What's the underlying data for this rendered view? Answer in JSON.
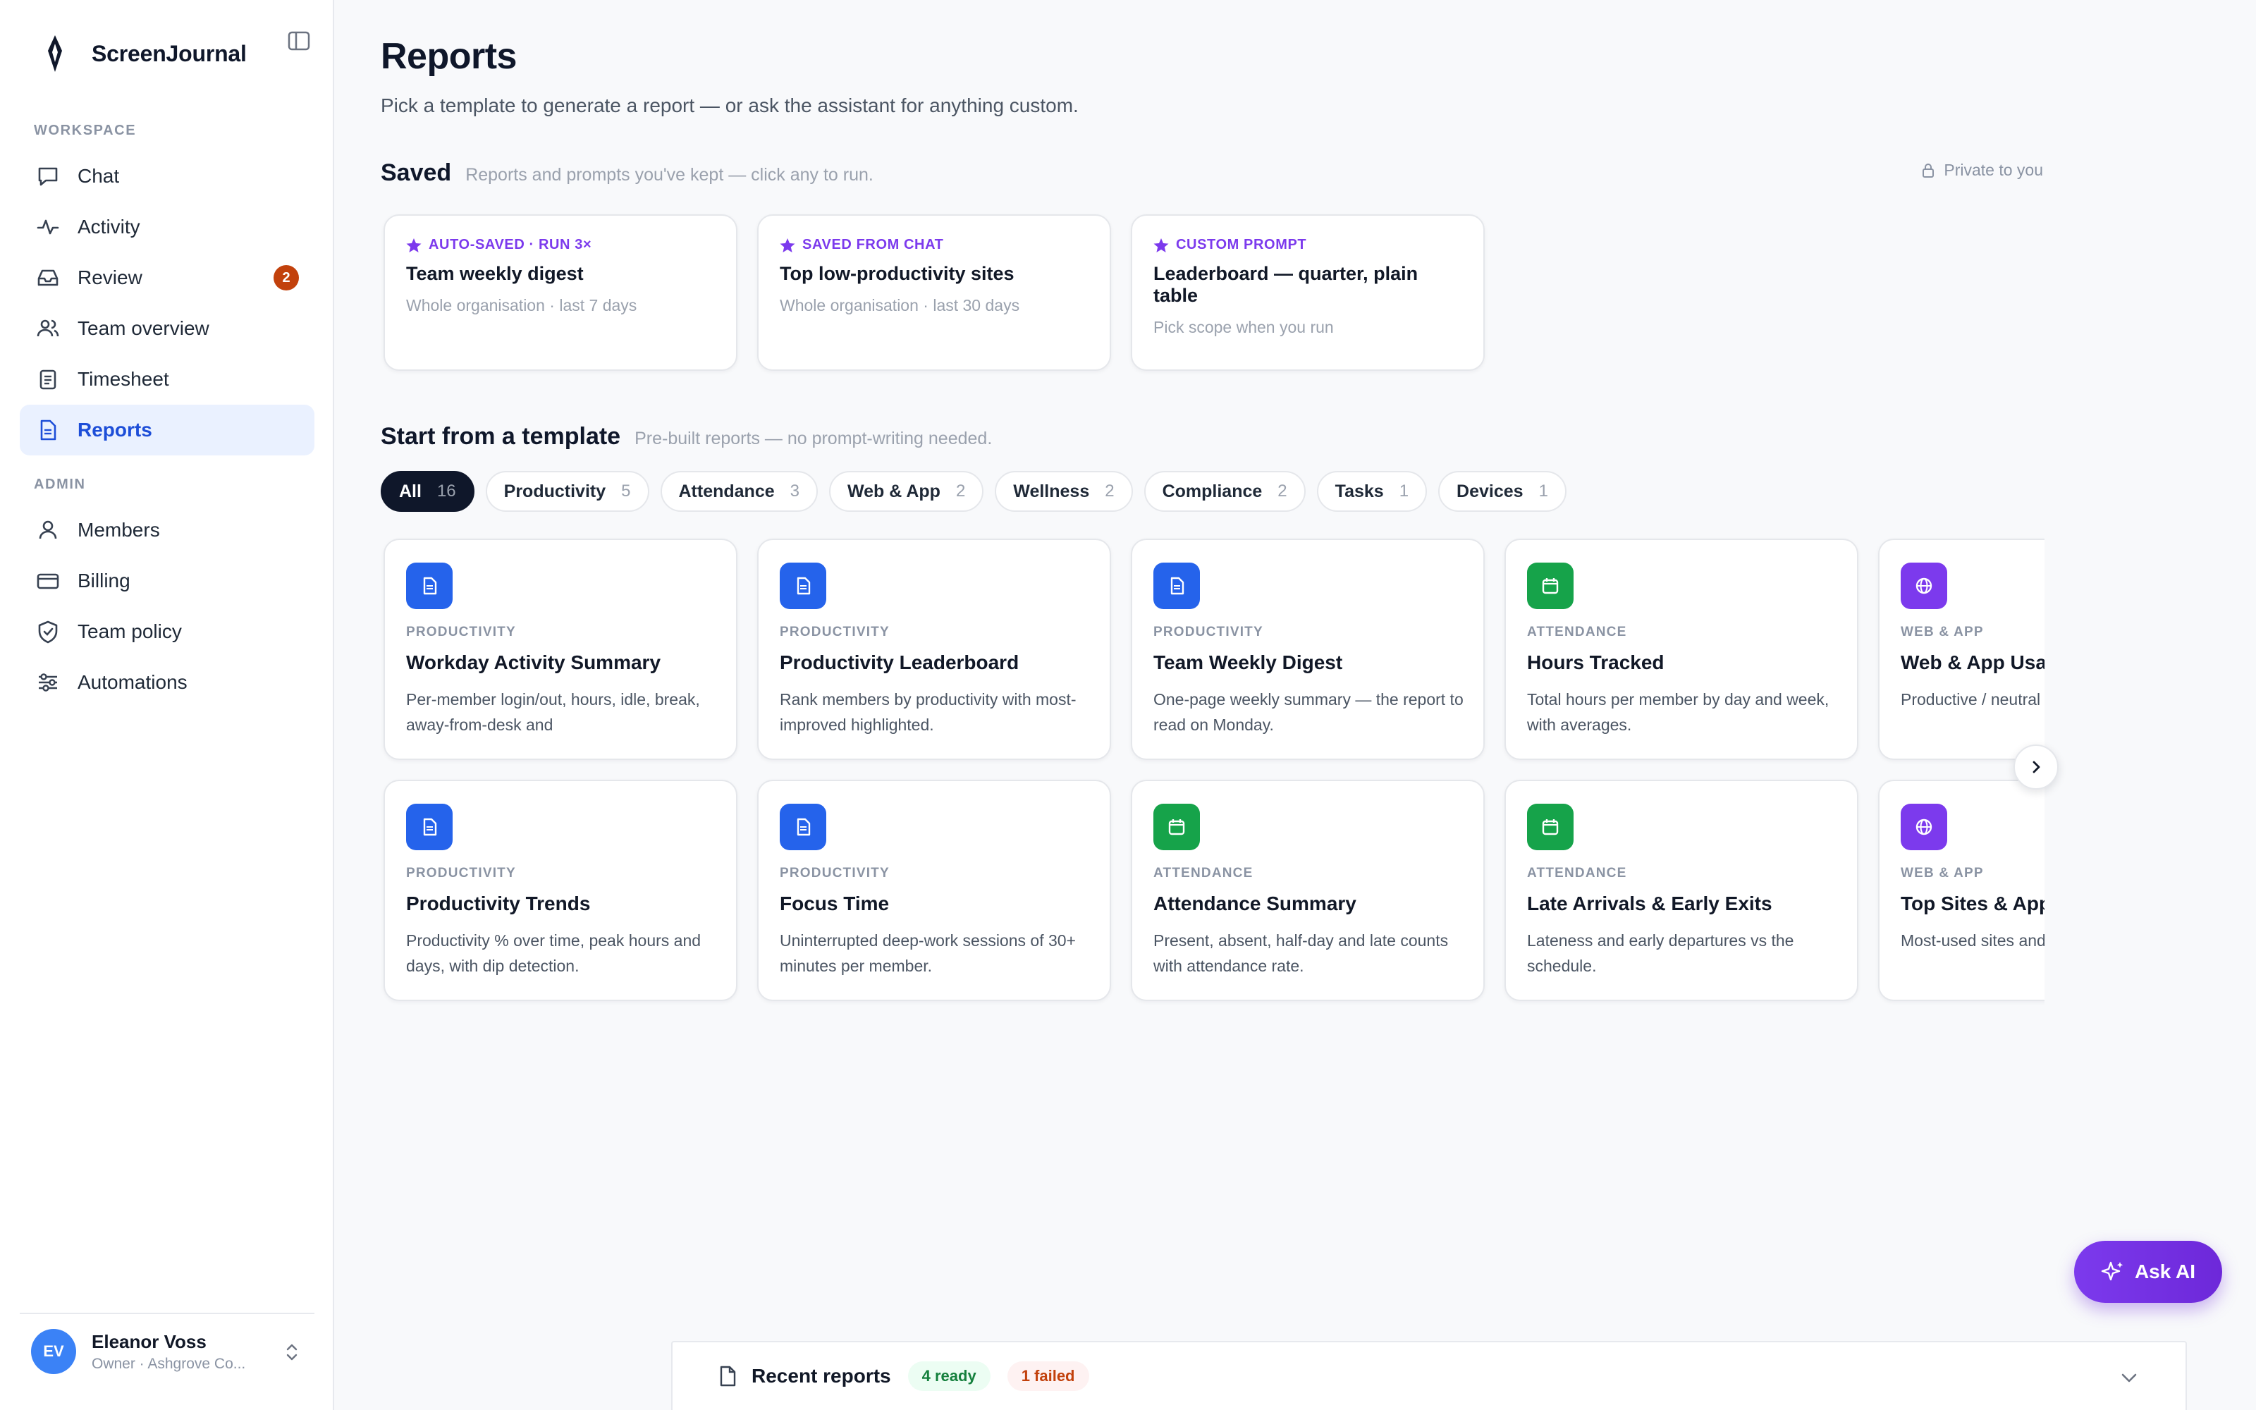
{
  "app": {
    "name": "ScreenJournal"
  },
  "sidebar": {
    "workspace_label": "WORKSPACE",
    "admin_label": "ADMIN",
    "workspace_items": [
      {
        "label": "Chat",
        "icon": "chat-icon"
      },
      {
        "label": "Activity",
        "icon": "activity-icon"
      },
      {
        "label": "Review",
        "icon": "inbox-icon",
        "badge": "2"
      },
      {
        "label": "Team overview",
        "icon": "users-icon"
      },
      {
        "label": "Timesheet",
        "icon": "clipboard-icon"
      },
      {
        "label": "Reports",
        "icon": "document-icon",
        "active": true
      }
    ],
    "admin_items": [
      {
        "label": "Members",
        "icon": "user-icon"
      },
      {
        "label": "Billing",
        "icon": "credit-card-icon"
      },
      {
        "label": "Team policy",
        "icon": "shield-icon"
      },
      {
        "label": "Automations",
        "icon": "sliders-icon"
      }
    ],
    "user": {
      "initials": "EV",
      "name": "Eleanor Voss",
      "role": "Owner · Ashgrove Co..."
    }
  },
  "page": {
    "title": "Reports",
    "subtitle": "Pick a template to generate a report — or ask the assistant for anything custom."
  },
  "saved": {
    "heading": "Saved",
    "subheading": "Reports and prompts you've kept — click any to run.",
    "privacy": "Private to you",
    "cards": [
      {
        "tag": "AUTO-SAVED · RUN 3×",
        "title": "Team weekly digest",
        "meta": "Whole organisation · last 7 days"
      },
      {
        "tag": "SAVED FROM CHAT",
        "title": "Top low-productivity sites",
        "meta": "Whole organisation · last 30 days"
      },
      {
        "tag": "CUSTOM PROMPT",
        "title": "Leaderboard — quarter, plain table",
        "meta": "Pick scope when you run"
      }
    ]
  },
  "templates": {
    "heading": "Start from a template",
    "subheading": "Pre-built reports — no prompt-writing needed.",
    "filters": [
      {
        "label": "All",
        "count": "16",
        "active": true
      },
      {
        "label": "Productivity",
        "count": "5"
      },
      {
        "label": "Attendance",
        "count": "3"
      },
      {
        "label": "Web & App",
        "count": "2"
      },
      {
        "label": "Wellness",
        "count": "2"
      },
      {
        "label": "Compliance",
        "count": "2"
      },
      {
        "label": "Tasks",
        "count": "1"
      },
      {
        "label": "Devices",
        "count": "1"
      }
    ],
    "cards": [
      {
        "category": "PRODUCTIVITY",
        "title": "Workday Activity Summary",
        "desc": "Per-member login/out, hours, idle, break, away-from-desk and",
        "icon": "document-icon",
        "color": "#2563eb"
      },
      {
        "category": "PRODUCTIVITY",
        "title": "Productivity Leaderboard",
        "desc": "Rank members by productivity with most-improved highlighted.",
        "icon": "document-icon",
        "color": "#2563eb"
      },
      {
        "category": "PRODUCTIVITY",
        "title": "Team Weekly Digest",
        "desc": "One-page weekly summary — the report to read on Monday.",
        "icon": "document-icon",
        "color": "#2563eb"
      },
      {
        "category": "ATTENDANCE",
        "title": "Hours Tracked",
        "desc": "Total hours per member by day and week, with averages.",
        "icon": "calendar-icon",
        "color": "#16a34a"
      },
      {
        "category": "WEB & APP",
        "title": "Web & App Usage",
        "desc": "Productive / neutral sites and apps.",
        "icon": "globe-icon",
        "color": "#7c3aed"
      },
      {
        "category": "PRODUCTIVITY",
        "title": "Productivity Trends",
        "desc": "Productivity % over time, peak hours and days, with dip detection.",
        "icon": "document-icon",
        "color": "#2563eb"
      },
      {
        "category": "PRODUCTIVITY",
        "title": "Focus Time",
        "desc": "Uninterrupted deep-work sessions of 30+ minutes per member.",
        "icon": "document-icon",
        "color": "#2563eb"
      },
      {
        "category": "ATTENDANCE",
        "title": "Attendance Summary",
        "desc": "Present, absent, half-day and late counts with attendance rate.",
        "icon": "calendar-icon",
        "color": "#16a34a"
      },
      {
        "category": "ATTENDANCE",
        "title": "Late Arrivals & Early Exits",
        "desc": "Lateness and early departures vs the schedule.",
        "icon": "calendar-icon",
        "color": "#16a34a"
      },
      {
        "category": "WEB & APP",
        "title": "Top Sites & Apps",
        "desc": "Most-used sites and visits, tagged by type.",
        "icon": "globe-icon",
        "color": "#7c3aed"
      }
    ]
  },
  "ask_ai": {
    "label": "Ask AI"
  },
  "recent": {
    "title": "Recent reports",
    "ready": "4 ready",
    "failed": "1 failed"
  }
}
